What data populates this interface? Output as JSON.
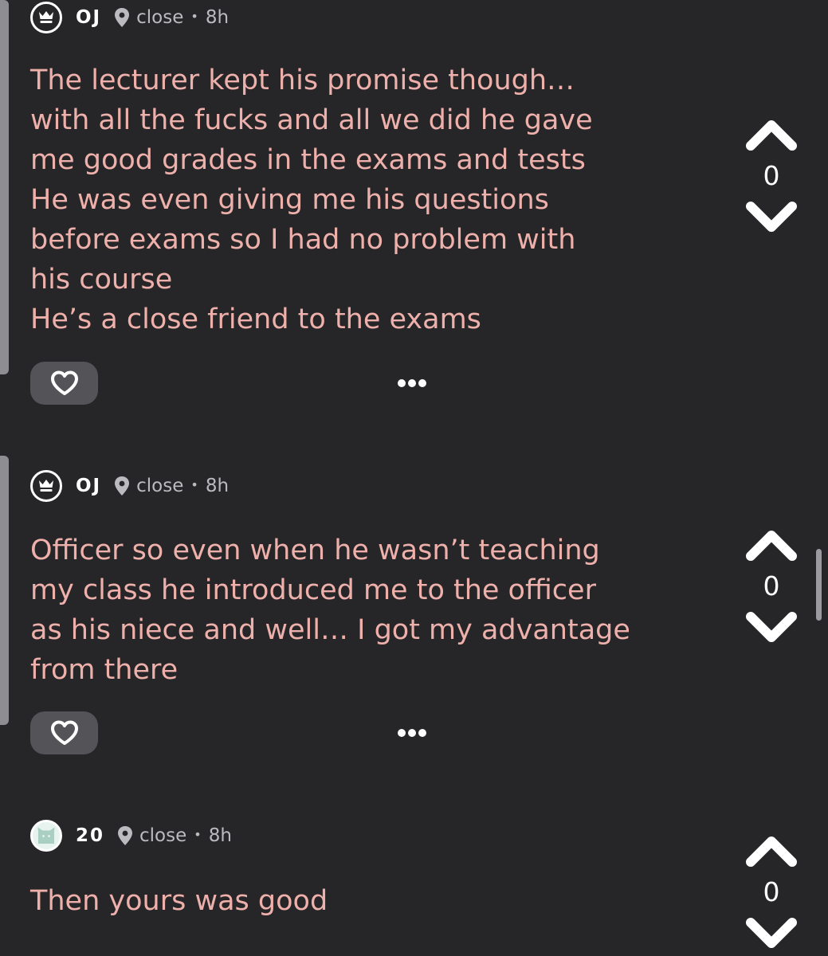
{
  "posts": [
    {
      "username": "OJ",
      "avatar_icon": "crown-icon",
      "location": "close",
      "time": "8h",
      "text": "The lecturer kept his promise though…\nwith all the fucks and all we did he gave\nme good grades in the exams and tests\nHe was even giving me his questions\nbefore exams so I had no problem with\nhis course\nHe’s a close friend to the exams",
      "votes": "0"
    },
    {
      "username": "OJ",
      "avatar_icon": "crown-icon",
      "location": "close",
      "time": "8h",
      "text": "Officer so even when he wasn’t teaching\nmy class he introduced me to the officer\nas his niece and well… I got my advantage\nfrom there",
      "votes": "0"
    },
    {
      "username": "20",
      "avatar_icon": "cat-icon",
      "location": "close",
      "time": "8h",
      "text": "Then yours was good",
      "votes": "0"
    }
  ],
  "colors": {
    "background": "#262528",
    "text": "#eeb0aa",
    "username": "#ffffff",
    "meta": "#bbbbbf",
    "like_button": "#545358",
    "thread_line": "#8e8d92"
  },
  "icons": {
    "like": "heart-icon",
    "more": "more-icon",
    "upvote": "chevron-up-icon",
    "downvote": "chevron-down-icon",
    "location": "location-pin-icon"
  }
}
